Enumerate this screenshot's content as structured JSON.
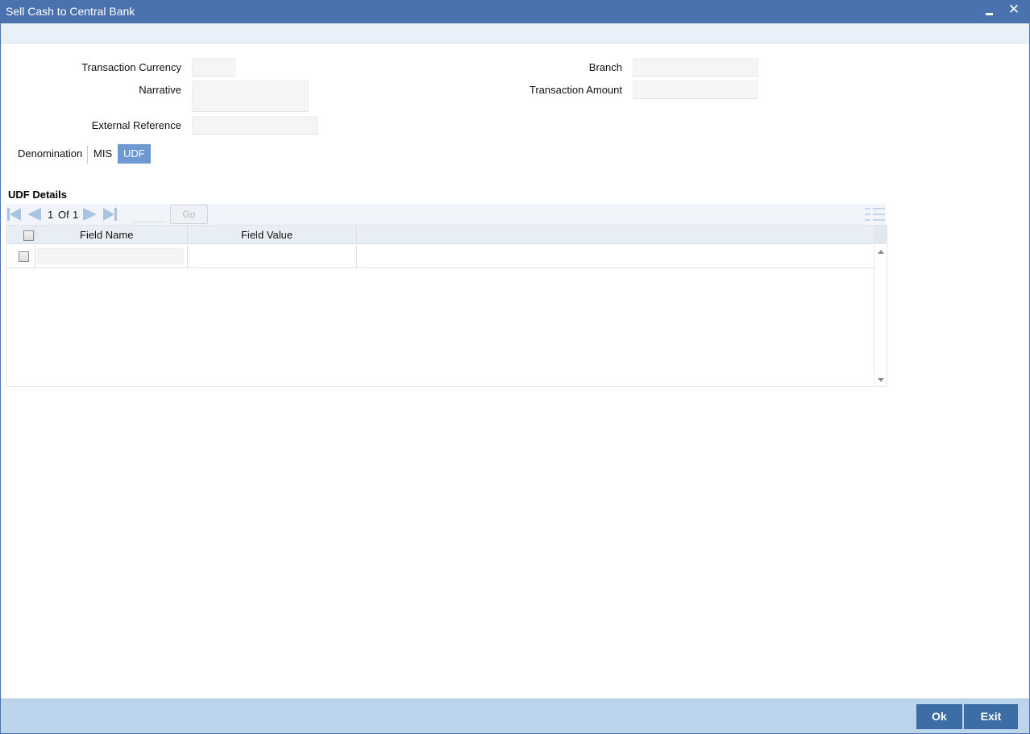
{
  "window": {
    "title": "Sell Cash to Central Bank",
    "minimize_icon": "minimize-icon",
    "close_icon": "close-icon",
    "close_glyph": "✕"
  },
  "form": {
    "transaction_currency_label": "Transaction Currency",
    "transaction_currency_value": "",
    "narrative_label": "Narrative",
    "narrative_value": "",
    "external_reference_label": "External Reference",
    "external_reference_value": "",
    "branch_label": "Branch",
    "branch_value": "",
    "transaction_amount_label": "Transaction Amount",
    "transaction_amount_value": ""
  },
  "tabs": [
    {
      "label": "Denomination",
      "active": false
    },
    {
      "label": "MIS",
      "active": false
    },
    {
      "label": "UDF",
      "active": true
    }
  ],
  "udf": {
    "section_title": "UDF Details",
    "pager": {
      "current": "1",
      "of_label": "Of",
      "total": "1",
      "go_label": "Go"
    },
    "columns": [
      "Field Name",
      "Field Value"
    ],
    "rows": [
      {
        "field_name": "",
        "field_value": ""
      }
    ]
  },
  "footer": {
    "ok_label": "Ok",
    "exit_label": "Exit"
  },
  "colors": {
    "titlebar": "#4a72ae",
    "active_tab": "#6e98d0",
    "footer": "#bdd5ec",
    "button": "#3c6ea5"
  }
}
